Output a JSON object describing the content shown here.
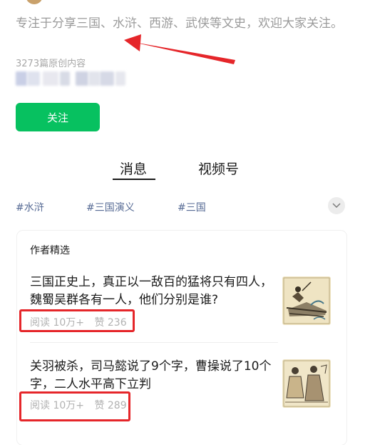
{
  "profile": {
    "description": "专注于分享三国、水浒、西游、武侠等文史，欢迎大家关注。",
    "article_count": "3273篇原创内容",
    "follow_label": "关注"
  },
  "tabs": [
    {
      "label": "消息",
      "active": true
    },
    {
      "label": "视频号",
      "active": false
    }
  ],
  "tags": [
    "#水浒",
    "#三国演义",
    "#三国"
  ],
  "featured": {
    "section_title": "作者精选",
    "articles": [
      {
        "title": "三国正史上，真正以一敌百的猛将只有四人，魏蜀吴群各有一人，他们分别是谁?",
        "reads": "阅读 10万+",
        "likes": "赞 236",
        "thumbnail": "ancient-battle-illustration"
      },
      {
        "title": "关羽被杀，司马懿说了9个字，曹操说了10个字，二人水平高下立判",
        "reads": "阅读 10万+",
        "likes": "赞 289",
        "thumbnail": "ancient-court-illustration"
      }
    ]
  },
  "colors": {
    "accent_green": "#07c160",
    "tag_blue": "#576b95",
    "annotation_red": "#e5262a"
  },
  "icons": [
    "chevron-down-icon",
    "red-arrow-annotation"
  ]
}
